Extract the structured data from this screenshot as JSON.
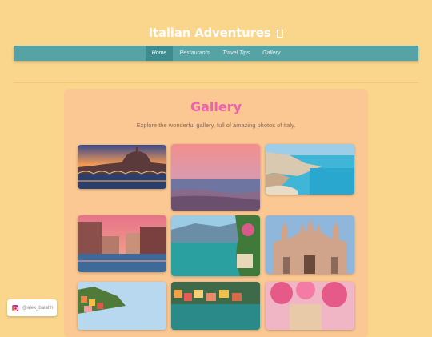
{
  "site": {
    "title": "Italian Adventures",
    "title_icon": "italy-flag-icon"
  },
  "nav": {
    "items": [
      {
        "label": "Home",
        "active": true
      },
      {
        "label": "Restaurants",
        "active": false
      },
      {
        "label": "Travel Tips",
        "active": false
      },
      {
        "label": "Gallery",
        "active": false
      }
    ]
  },
  "gallery": {
    "title": "Gallery",
    "subtitle": "Explore the wonderful gallery, full of amazing photos of italy."
  },
  "photos": [
    {
      "subject": "rome-vatican-sunset"
    },
    {
      "subject": "pink-sea-sunset"
    },
    {
      "subject": "amalfi-coast-cove"
    },
    {
      "subject": "venice-grand-canal"
    },
    {
      "subject": "lake-como-villa"
    },
    {
      "subject": "milan-duomo"
    },
    {
      "subject": "cinque-terre-village"
    },
    {
      "subject": "portofino-harbor"
    },
    {
      "subject": "pink-flowers-town"
    }
  ],
  "social": {
    "icon": "instagram-icon",
    "handle": "@alex_baiahh"
  },
  "colors": {
    "background": "#fad68c",
    "navbar": "#56a3a6",
    "nav_active": "#3e8b8f",
    "panel": "#fbc893",
    "gallery_title": "#f05fb0"
  }
}
